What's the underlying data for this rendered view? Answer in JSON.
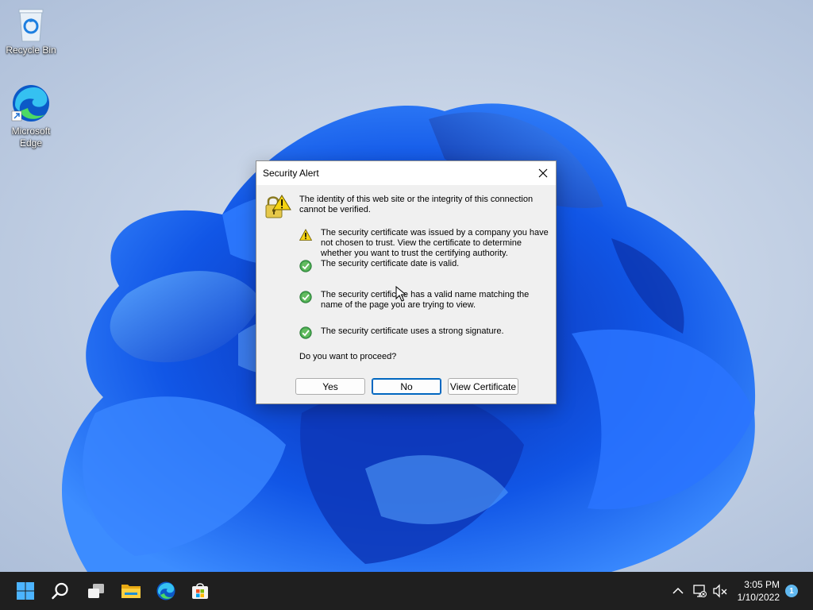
{
  "desktop": {
    "icons": [
      {
        "label": "Recycle Bin",
        "icon": "recycle-bin-icon"
      },
      {
        "label": "Microsoft Edge",
        "icon": "edge-icon"
      }
    ]
  },
  "dialog": {
    "title": "Security Alert",
    "intro": "The identity of this web site or the integrity of this connection cannot be verified.",
    "items": [
      {
        "status": "warning",
        "icon": "warning-icon",
        "text": "The security certificate was issued by a company you have not chosen to trust. View the certificate to determine whether you want to trust the certifying authority."
      },
      {
        "status": "ok",
        "icon": "check-icon",
        "text": "The security certificate date is valid."
      },
      {
        "status": "ok",
        "icon": "check-icon",
        "text": "The security certificate has a valid name matching the name of the page you are trying to view."
      },
      {
        "status": "ok",
        "icon": "check-icon",
        "text": "The security certificate uses a strong signature."
      }
    ],
    "question": "Do you want to proceed?",
    "buttons": {
      "yes": "Yes",
      "no": "No",
      "view_certificate": "View Certificate"
    },
    "default_button": "No"
  },
  "taskbar": {
    "apps": [
      "start-icon",
      "search-icon",
      "task-view-icon",
      "file-explorer-icon",
      "edge-icon",
      "store-icon"
    ],
    "tray": [
      "chevron-up-icon",
      "network-icon",
      "volume-muted-icon"
    ],
    "time": "3:05 PM",
    "date": "1/10/2022",
    "notification_count": "1"
  },
  "colors": {
    "accent": "#0067c0",
    "taskbar": "#1f1f1f",
    "bloom": "#1a5fe0",
    "warning": "#f5d312",
    "ok": "#3ea14a"
  }
}
